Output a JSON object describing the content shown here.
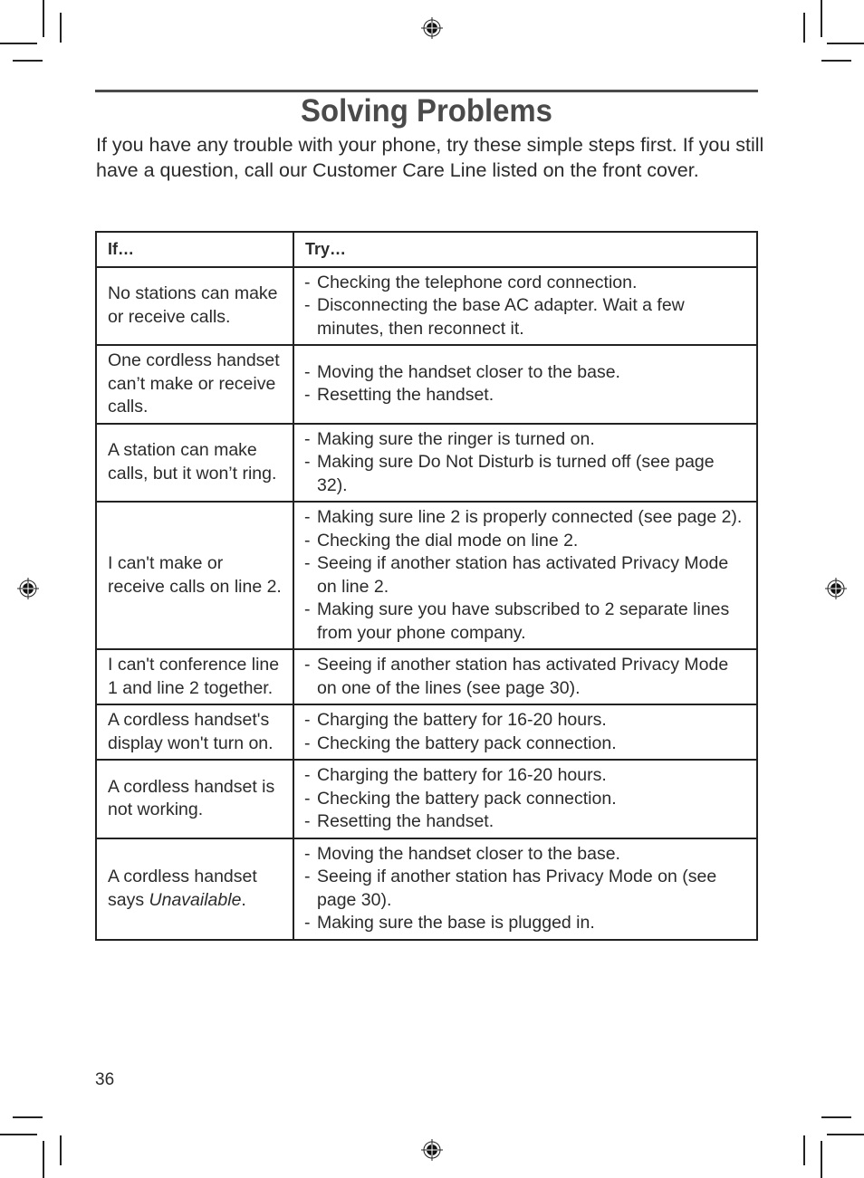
{
  "page": {
    "title": "Solving Problems",
    "intro": "If you have any trouble with your phone, try these simple steps first. If you still have a question, call our Customer Care Line listed on the front cover.",
    "page_number": "36"
  },
  "table": {
    "headers": {
      "if": "If…",
      "try": "Try…"
    },
    "rows": [
      {
        "if": "No stations can make or receive calls.",
        "try": [
          "Checking the telephone cord connection.",
          "Disconnecting the base AC adapter. Wait a few minutes, then reconnect it."
        ]
      },
      {
        "if": "One cordless handset can’t make or receive calls.",
        "try": [
          "Moving the handset closer to the base.",
          "Resetting the handset."
        ]
      },
      {
        "if": "A station can make calls, but it won’t ring.",
        "try": [
          "Making sure the ringer is turned on.",
          "Making sure Do Not Disturb is turned off (see page 32)."
        ]
      },
      {
        "if": "I can't make or receive calls on line 2.",
        "try": [
          "Making sure line 2 is properly connected (see page 2).",
          "Checking the dial mode on line 2.",
          "Seeing if another station has activated Privacy Mode on line 2.",
          "Making sure you have subscribed to 2 separate lines from your phone company."
        ]
      },
      {
        "if": "I can't conference line 1 and line 2 together.",
        "try": [
          "Seeing if another station has activated Privacy Mode on one of the lines (see page 30)."
        ]
      },
      {
        "if": "A cordless handset's display won't turn on.",
        "try": [
          "Charging the battery for 16-20 hours.",
          "Checking the battery pack connection."
        ]
      },
      {
        "if": "A cordless handset is not working.",
        "try": [
          "Charging the battery for 16-20 hours.",
          "Checking the battery pack connection.",
          "Resetting the handset."
        ]
      },
      {
        "if_prefix": "A cordless handset says ",
        "if_emphasis": "Unavailable",
        "if_suffix": ".",
        "try": [
          "Moving the handset closer to the base.",
          "Seeing if another station has Privacy Mode on (see page 30).",
          "Making sure the base is plugged in."
        ]
      }
    ]
  },
  "colors": {
    "title": "#4a4a4a",
    "rule": "#4a4a4a",
    "text": "#2b2b2b",
    "border": "#222222"
  },
  "icons": {
    "registration_mark": "registration-crosshair-icon"
  }
}
